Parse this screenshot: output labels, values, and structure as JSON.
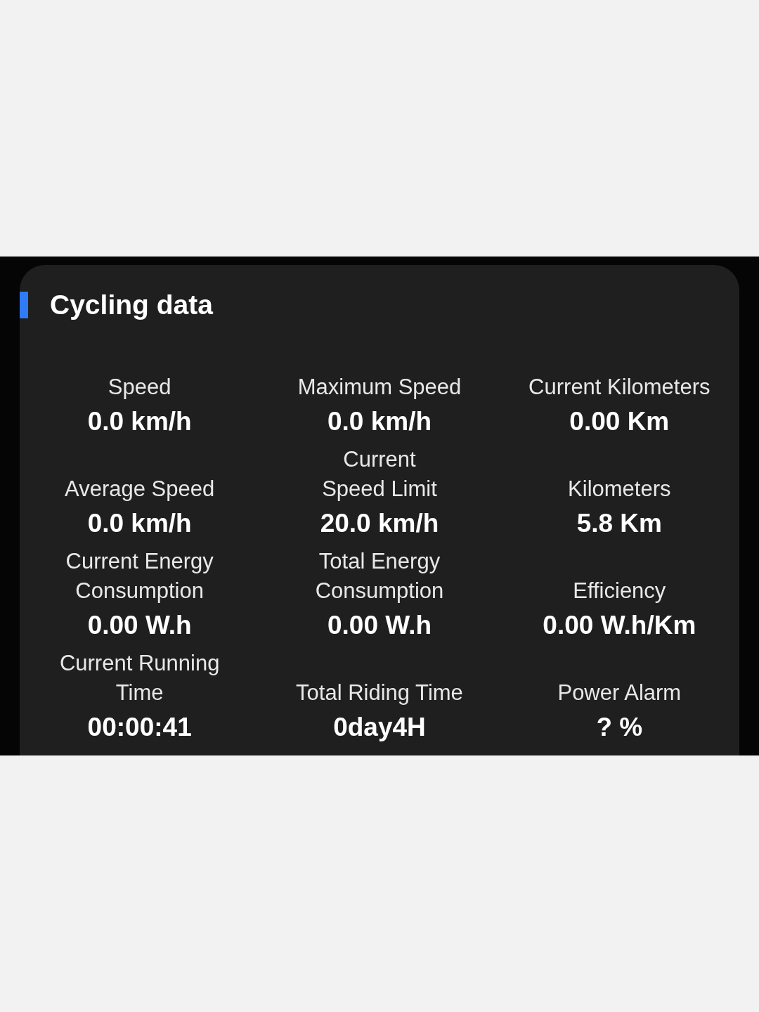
{
  "card": {
    "title": "Cycling data",
    "metrics": [
      {
        "label": "Speed",
        "value": "0.0 km/h"
      },
      {
        "label": "Maximum Speed",
        "value": "0.0 km/h"
      },
      {
        "label": "Current Kilometers",
        "value": "0.00 Km"
      },
      {
        "label": "Average Speed",
        "value": "0.0 km/h"
      },
      {
        "label": "Current\nSpeed Limit",
        "value": "20.0 km/h"
      },
      {
        "label": "Kilometers",
        "value": "5.8 Km"
      },
      {
        "label": "Current Energy\nConsumption",
        "value": "0.00 W.h"
      },
      {
        "label": "Total Energy\nConsumption",
        "value": "0.00 W.h"
      },
      {
        "label": "Efficiency",
        "value": "0.00 W.h/Km"
      },
      {
        "label": "Current Running\nTime",
        "value": "00:00:41"
      },
      {
        "label": "Total Riding Time",
        "value": "0day4H"
      },
      {
        "label": "Power Alarm",
        "value": "? %"
      }
    ]
  }
}
